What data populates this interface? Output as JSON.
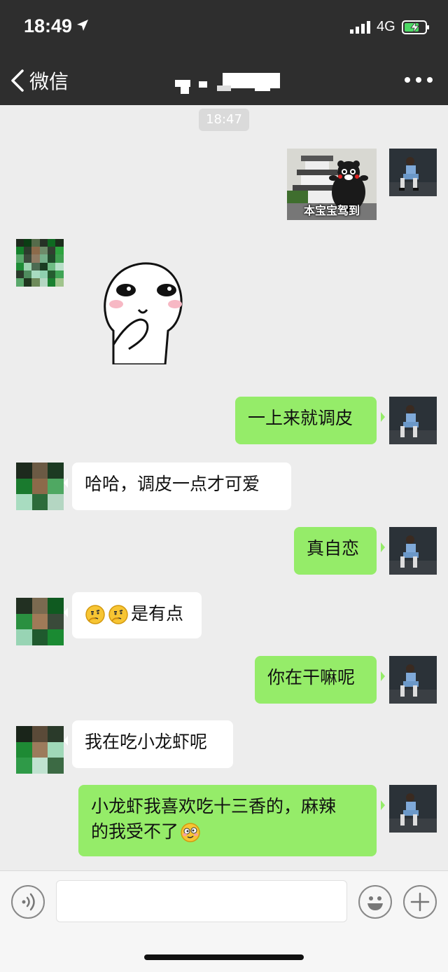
{
  "status_bar": {
    "time": "18:49",
    "network": "4G"
  },
  "nav": {
    "back_label": "微信",
    "title": ""
  },
  "timestamp": "18:47",
  "colors": {
    "header": "#2e2e2e",
    "my_bubble": "#95ec69",
    "their_bubble": "#ffffff",
    "background": "#ededed"
  },
  "messages": [
    {
      "from": "me",
      "type": "sticker",
      "caption": "本宝宝驾到"
    },
    {
      "from": "other",
      "type": "sticker",
      "caption": ""
    },
    {
      "from": "me",
      "type": "text",
      "text": "一上来就调皮"
    },
    {
      "from": "other",
      "type": "text",
      "text": "哈哈，调皮一点才可爱"
    },
    {
      "from": "me",
      "type": "text",
      "text": "真自恋"
    },
    {
      "from": "other",
      "type": "text",
      "text": "是有点",
      "emoji_prefix": [
        "thinking-emoji",
        "thinking-emoji"
      ]
    },
    {
      "from": "me",
      "type": "text",
      "text": "你在干嘛呢"
    },
    {
      "from": "other",
      "type": "text",
      "text": "我在吃小龙虾呢"
    },
    {
      "from": "me",
      "type": "text",
      "text_line1": "小龙虾我喜欢吃十三香的，麻辣",
      "text_line2": "的我受不了",
      "emoji_suffix": "dizzy-emoji"
    }
  ],
  "input_bar": {
    "voice_icon": "voice-icon",
    "emoji_icon": "emoji-icon",
    "plus_icon": "plus-icon"
  }
}
